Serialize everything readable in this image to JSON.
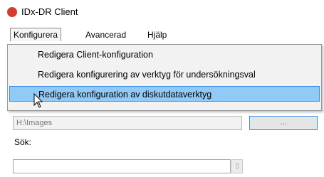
{
  "window": {
    "title": "IDx-DR Client"
  },
  "menubar": {
    "items": [
      {
        "label": "Konfigurera"
      },
      {
        "label": "Avancerad"
      },
      {
        "label": "Hjälp"
      }
    ]
  },
  "dropdown": {
    "items": [
      {
        "label": "Redigera Client-konfiguration"
      },
      {
        "label": "Redigera konfigurering av verktyg för undersökningsval"
      },
      {
        "label": "Redigera konfiguration av diskutdataverktyg"
      }
    ]
  },
  "form": {
    "path_value": "H:\\Images",
    "browse_label": "...",
    "search_label": "Sök:",
    "search_value": ""
  },
  "colors": {
    "accent": "#3a8ee6",
    "highlight": "#91c9f7",
    "app_icon": "#d63b2f"
  },
  "icons": {
    "app": "app-logo-icon",
    "cursor": "mouse-pointer-icon"
  }
}
